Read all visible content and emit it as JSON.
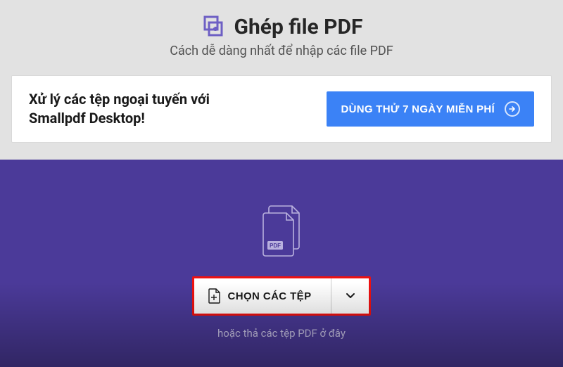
{
  "header": {
    "title": "Ghép file PDF",
    "subtitle": "Cách dễ dàng nhất để nhập các file PDF"
  },
  "promo": {
    "text": "Xử lý các tệp ngoại tuyến với Smallpdf Desktop!",
    "cta": "DÙNG THỬ 7 NGÀY MIỄN PHÍ"
  },
  "upload": {
    "choose_label": "CHỌN CÁC TỆP",
    "drop_hint": "hoặc thả các tệp PDF ở đây"
  },
  "colors": {
    "accent": "#5a4bad",
    "cta": "#3b82f6",
    "highlight": "#e11"
  }
}
